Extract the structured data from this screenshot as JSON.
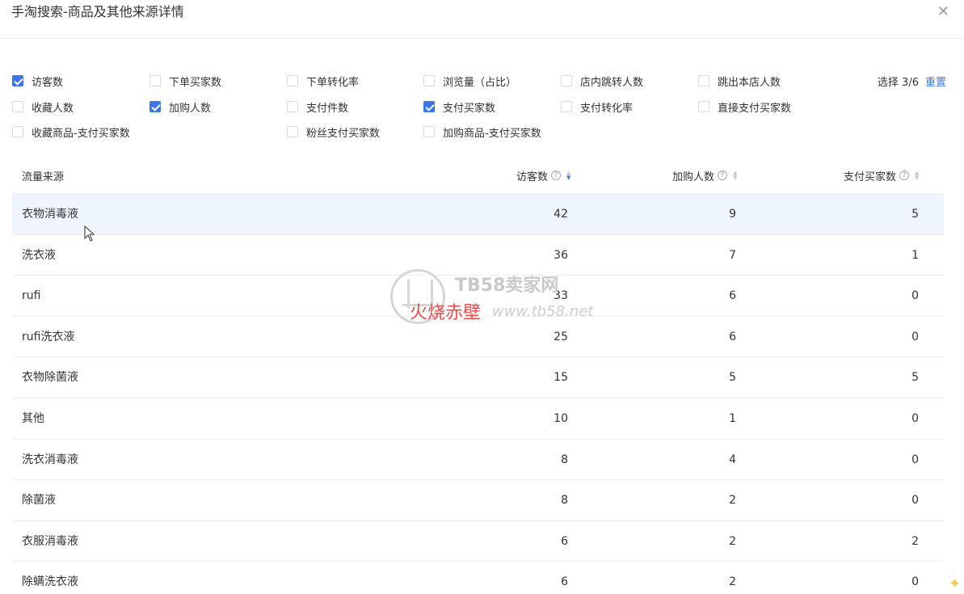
{
  "dialog": {
    "title": "手淘搜索-商品及其他来源详情",
    "close_icon": "close-icon"
  },
  "filters": {
    "items": [
      {
        "label": "访客数",
        "checked": true
      },
      {
        "label": "下单买家数",
        "checked": false
      },
      {
        "label": "下单转化率",
        "checked": false
      },
      {
        "label": "浏览量（占比）",
        "checked": false
      },
      {
        "label": "店内跳转人数",
        "checked": false
      },
      {
        "label": "跳出本店人数",
        "checked": false
      },
      {
        "label": "收藏人数",
        "checked": false
      },
      {
        "label": "加购人数",
        "checked": true
      },
      {
        "label": "支付件数",
        "checked": false
      },
      {
        "label": "支付买家数",
        "checked": true
      },
      {
        "label": "支付转化率",
        "checked": false
      },
      {
        "label": "直接支付买家数",
        "checked": false
      },
      {
        "label": "收藏商品-支付买家数",
        "checked": false
      },
      {
        "label": "粉丝支付买家数",
        "checked": false
      },
      {
        "label": "加购商品-支付买家数",
        "checked": false
      }
    ],
    "select_count": "选择 3/6",
    "reset_label": "重置"
  },
  "table": {
    "columns": [
      "流量来源",
      "访客数",
      "加购人数",
      "支付买家数"
    ],
    "rows": [
      [
        "衣物消毒液",
        "42",
        "9",
        "5"
      ],
      [
        "洗衣液",
        "36",
        "7",
        "1"
      ],
      [
        "rufi",
        "33",
        "6",
        "0"
      ],
      [
        "rufi洗衣液",
        "25",
        "6",
        "0"
      ],
      [
        "衣物除菌液",
        "15",
        "5",
        "5"
      ],
      [
        "其他",
        "10",
        "1",
        "0"
      ],
      [
        "洗衣消毒液",
        "8",
        "4",
        "0"
      ],
      [
        "除菌液",
        "8",
        "2",
        "0"
      ],
      [
        "衣服消毒液",
        "6",
        "2",
        "2"
      ],
      [
        "除螨洗衣液",
        "6",
        "2",
        "0"
      ]
    ]
  },
  "watermark": {
    "site": "TB58卖家网",
    "red_text": "火烧赤壁",
    "url": "www.tb58.net"
  },
  "colors": {
    "accent": "#3a76e8",
    "highlight_row": "#eef5fc"
  }
}
